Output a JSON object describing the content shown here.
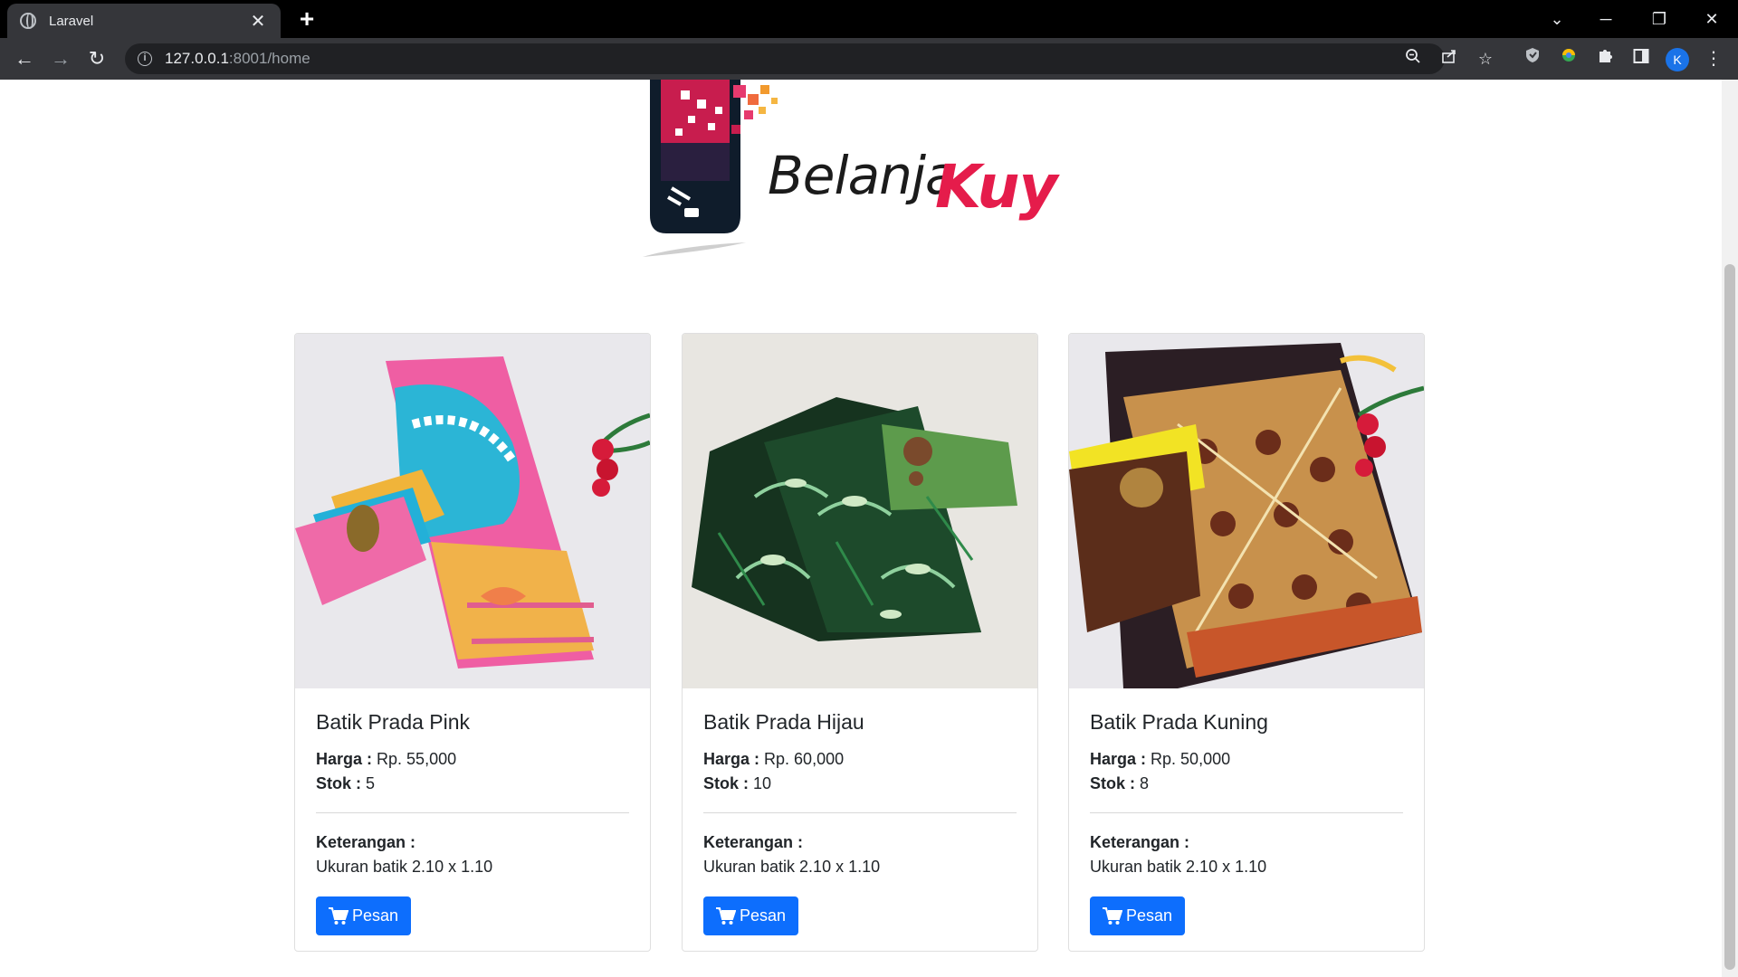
{
  "browser": {
    "tab_title": "Laravel",
    "tab_close": "✕",
    "new_tab": "+",
    "url_host": "127.0.0.1",
    "url_rest": ":8001/home",
    "profile_initial": "K"
  },
  "logo": {
    "word1": "Belanja",
    "word2": "Kuy",
    "colors": {
      "dark": "#0f1c2b",
      "accent": "#e51c4b",
      "orange": "#f29a2e"
    }
  },
  "products": [
    {
      "name": "Batik Prada Pink",
      "price_label": "Harga :",
      "price": "Rp. 55,000",
      "stock_label": "Stok :",
      "stock": "5",
      "desc_label": "Keterangan :",
      "desc": "Ukuran batik 2.10 x 1.10",
      "button": "Pesan"
    },
    {
      "name": "Batik Prada Hijau",
      "price_label": "Harga :",
      "price": "Rp. 60,000",
      "stock_label": "Stok :",
      "stock": "10",
      "desc_label": "Keterangan :",
      "desc": "Ukuran batik 2.10 x 1.10",
      "button": "Pesan"
    },
    {
      "name": "Batik Prada Kuning",
      "price_label": "Harga :",
      "price": "Rp. 50,000",
      "stock_label": "Stok :",
      "stock": "8",
      "desc_label": "Keterangan :",
      "desc": "Ukuran batik 2.10 x 1.10",
      "button": "Pesan"
    }
  ],
  "colors": {
    "primary_button": "#0d6efd",
    "browser_dark": "#35363a"
  }
}
